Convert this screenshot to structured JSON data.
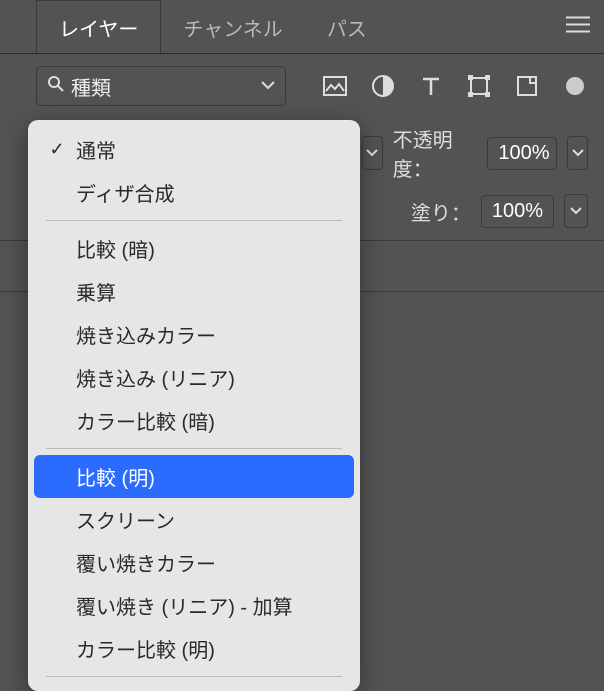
{
  "tabs": {
    "layers": "レイヤー",
    "channels": "チャンネル",
    "paths": "パス"
  },
  "search": {
    "label": "種類"
  },
  "opacity": {
    "label": "不透明度：",
    "value": "100%"
  },
  "fill": {
    "label": "塗り：",
    "value": "100%"
  },
  "blend_modes": {
    "checked": "通常",
    "highlighted": "比較 (明)",
    "group1": [
      "通常",
      "ディザ合成"
    ],
    "group2": [
      "比較 (暗)",
      "乗算",
      "焼き込みカラー",
      "焼き込み (リニア)",
      "カラー比較 (暗)"
    ],
    "group3": [
      "比較 (明)",
      "スクリーン",
      "覆い焼きカラー",
      "覆い焼き (リニア) - 加算",
      "カラー比較 (明)"
    ]
  }
}
